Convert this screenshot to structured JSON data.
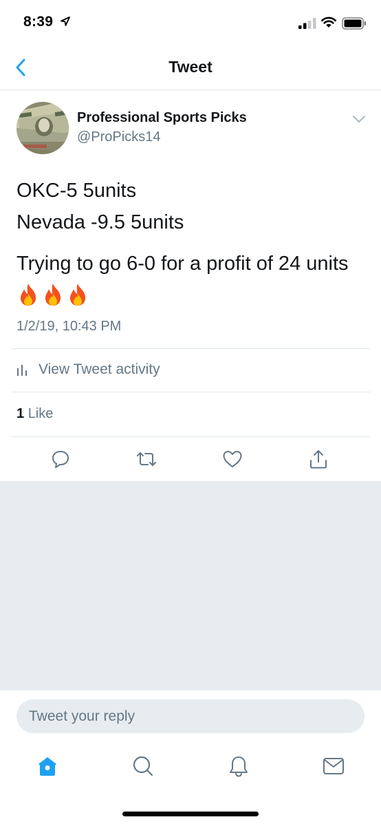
{
  "status_bar": {
    "time": "8:39"
  },
  "nav": {
    "title": "Tweet"
  },
  "tweet": {
    "author_name": "Professional Sports Picks",
    "author_handle": "@ProPicks14",
    "lines": [
      "OKC-5 5units",
      "Nevada -9.5 5units",
      "Trying to go 6-0 for a profit of 24 units"
    ],
    "emoji_count": 3,
    "timestamp": "1/2/19, 10:43 PM"
  },
  "activity": {
    "label": "View Tweet activity"
  },
  "likes": {
    "count": "1",
    "label": "Like"
  },
  "reply": {
    "placeholder": "Tweet your reply"
  },
  "colors": {
    "accent": "#1da1f2",
    "text": "#14171a",
    "secondary": "#657786",
    "divider": "#e1e8ed",
    "background_gray": "#e6ecf0"
  },
  "icons": {
    "actions": [
      "reply-icon",
      "retweet-icon",
      "like-icon",
      "share-icon"
    ],
    "tabs": [
      "home-icon",
      "search-icon",
      "notifications-icon",
      "messages-icon"
    ]
  }
}
